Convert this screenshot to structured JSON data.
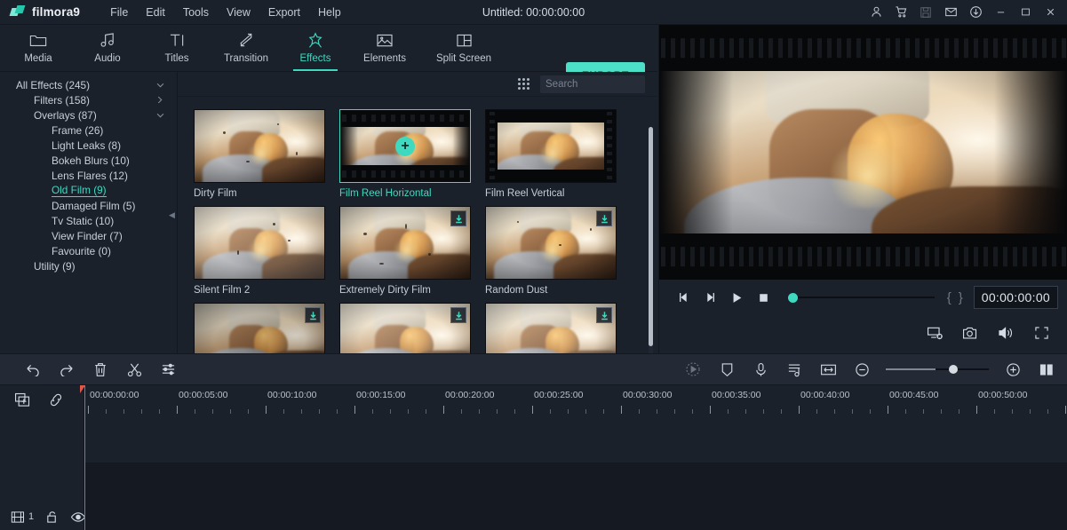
{
  "app": {
    "brand": "filmora9",
    "title": "Untitled: 00:00:00:00"
  },
  "menu": [
    {
      "label": "File"
    },
    {
      "label": "Edit"
    },
    {
      "label": "Tools"
    },
    {
      "label": "View"
    },
    {
      "label": "Export"
    },
    {
      "label": "Help"
    }
  ],
  "window_controls": [
    {
      "name": "account-icon",
      "glyph": "person"
    },
    {
      "name": "cart-icon",
      "glyph": "cart"
    },
    {
      "name": "save-icon",
      "glyph": "save",
      "disabled": true
    },
    {
      "name": "mail-icon",
      "glyph": "mail"
    },
    {
      "name": "download-icon",
      "glyph": "download"
    },
    {
      "name": "minimize-button",
      "glyph": "minimize"
    },
    {
      "name": "maximize-button",
      "glyph": "maximize"
    },
    {
      "name": "close-button",
      "glyph": "close"
    }
  ],
  "toolbar": {
    "tabs": [
      {
        "label": "Media",
        "icon": "folder-icon",
        "active": false
      },
      {
        "label": "Audio",
        "icon": "music-note-icon",
        "active": false
      },
      {
        "label": "Titles",
        "icon": "text-icon",
        "active": false
      },
      {
        "label": "Transition",
        "icon": "arrows-icon",
        "active": false
      },
      {
        "label": "Effects",
        "icon": "sparkle-icon",
        "active": true
      },
      {
        "label": "Elements",
        "icon": "image-icon",
        "active": false
      },
      {
        "label": "Split Screen",
        "icon": "split-screen-icon",
        "active": false
      }
    ],
    "export_label": "EXPORT"
  },
  "sidebar": {
    "items": [
      {
        "label": "All Effects (245)",
        "level": 0,
        "chevron": "down",
        "selected": false
      },
      {
        "label": "Filters (158)",
        "level": 1,
        "chevron": "right",
        "selected": false
      },
      {
        "label": "Overlays (87)",
        "level": 1,
        "chevron": "down",
        "selected": false
      },
      {
        "label": "Frame (26)",
        "level": 2,
        "chevron": "",
        "selected": false
      },
      {
        "label": "Light Leaks (8)",
        "level": 2,
        "chevron": "",
        "selected": false
      },
      {
        "label": "Bokeh Blurs (10)",
        "level": 2,
        "chevron": "",
        "selected": false
      },
      {
        "label": "Lens Flares (12)",
        "level": 2,
        "chevron": "",
        "selected": false
      },
      {
        "label": "Old Film (9)",
        "level": 2,
        "chevron": "",
        "selected": true
      },
      {
        "label": "Damaged Film (5)",
        "level": 2,
        "chevron": "",
        "selected": false
      },
      {
        "label": "Tv Static (10)",
        "level": 2,
        "chevron": "",
        "selected": false
      },
      {
        "label": "View Finder (7)",
        "level": 2,
        "chevron": "",
        "selected": false
      },
      {
        "label": "Favourite (0)",
        "level": 2,
        "chevron": "",
        "selected": false
      },
      {
        "label": "Utility (9)",
        "level": 1,
        "chevron": "",
        "selected": false
      }
    ]
  },
  "search": {
    "placeholder": "Search",
    "value": ""
  },
  "effects_grid": {
    "items": [
      {
        "label": "Dirty Film",
        "overlay": "dust",
        "hovered": false,
        "download": false
      },
      {
        "label": "Film Reel Horizontal",
        "overlay": "reel-h",
        "hovered": true,
        "download": false
      },
      {
        "label": "Film Reel Vertical",
        "overlay": "reel-v",
        "hovered": false,
        "download": false
      },
      {
        "label": "Silent Film 2",
        "overlay": "bright",
        "hovered": false,
        "download": false
      },
      {
        "label": "Extremely Dirty Film",
        "overlay": "dust",
        "hovered": false,
        "download": true
      },
      {
        "label": "Random Dust",
        "overlay": "dust",
        "hovered": false,
        "download": true
      },
      {
        "label": "",
        "overlay": "dark",
        "hovered": false,
        "download": true
      },
      {
        "label": "",
        "overlay": "bright",
        "hovered": false,
        "download": true
      },
      {
        "label": "",
        "overlay": "bright",
        "hovered": false,
        "download": true
      }
    ],
    "plus_glyph": "+"
  },
  "preview": {
    "controls": [
      {
        "name": "previous-frame-button",
        "glyph": "prev-frame"
      },
      {
        "name": "next-frame-button",
        "glyph": "next-frame"
      },
      {
        "name": "play-button",
        "glyph": "play"
      },
      {
        "name": "stop-button",
        "glyph": "stop"
      }
    ],
    "mark_in": "{",
    "mark_out": "}",
    "timecode": "00:00:00:00",
    "progress_percent": 0,
    "bottom_controls": [
      {
        "name": "display-settings-icon",
        "glyph": "display"
      },
      {
        "name": "snapshot-icon",
        "glyph": "camera"
      },
      {
        "name": "volume-icon",
        "glyph": "volume"
      },
      {
        "name": "fullscreen-icon",
        "glyph": "fullscreen"
      }
    ]
  },
  "timeline_toolbar": {
    "left": [
      {
        "name": "undo-button",
        "glyph": "undo"
      },
      {
        "name": "redo-button",
        "glyph": "redo"
      },
      {
        "name": "delete-button",
        "glyph": "trash"
      },
      {
        "name": "split-button",
        "glyph": "scissors"
      },
      {
        "name": "adjust-button",
        "glyph": "sliders"
      }
    ],
    "right": [
      {
        "name": "speed-button",
        "glyph": "speed",
        "disabled": true
      },
      {
        "name": "color-marker-button",
        "glyph": "shield"
      },
      {
        "name": "voiceover-button",
        "glyph": "mic"
      },
      {
        "name": "audio-mixer-button",
        "glyph": "mixer"
      },
      {
        "name": "fit-timeline-button",
        "glyph": "fit"
      },
      {
        "name": "zoom-out-button",
        "glyph": "zoom-out"
      },
      {
        "name": "zoom-in-button",
        "glyph": "zoom-in"
      },
      {
        "name": "layout-toggle-button",
        "glyph": "panels"
      }
    ],
    "zoom_percent": 61
  },
  "timeline": {
    "ruler_labels": [
      "00:00:00:00",
      "00:00:05:00",
      "00:00:10:00",
      "00:00:15:00",
      "00:00:20:00",
      "00:00:25:00",
      "00:00:30:00",
      "00:00:35:00",
      "00:00:40:00",
      "00:00:45:00",
      "00:00:50:00"
    ],
    "ruler_spacing_px": 100,
    "playhead_position": "00:00:00:00",
    "track_head_top": [
      {
        "name": "add-track-icon",
        "glyph": "add-track"
      },
      {
        "name": "link-icon",
        "glyph": "link"
      }
    ],
    "track_number": "1",
    "track_head_bottom": [
      {
        "name": "track-type-icon",
        "glyph": "film"
      },
      {
        "name": "lock-icon",
        "glyph": "unlock"
      },
      {
        "name": "visibility-icon",
        "glyph": "eye"
      }
    ]
  },
  "colors": {
    "accent": "#3fd9c0",
    "export_button": "#4de0c8",
    "playhead": "#e2574c",
    "panel_bg": "#1b212b",
    "timeline_bg": "#151a22",
    "toolbar_bg": "#232a36"
  }
}
